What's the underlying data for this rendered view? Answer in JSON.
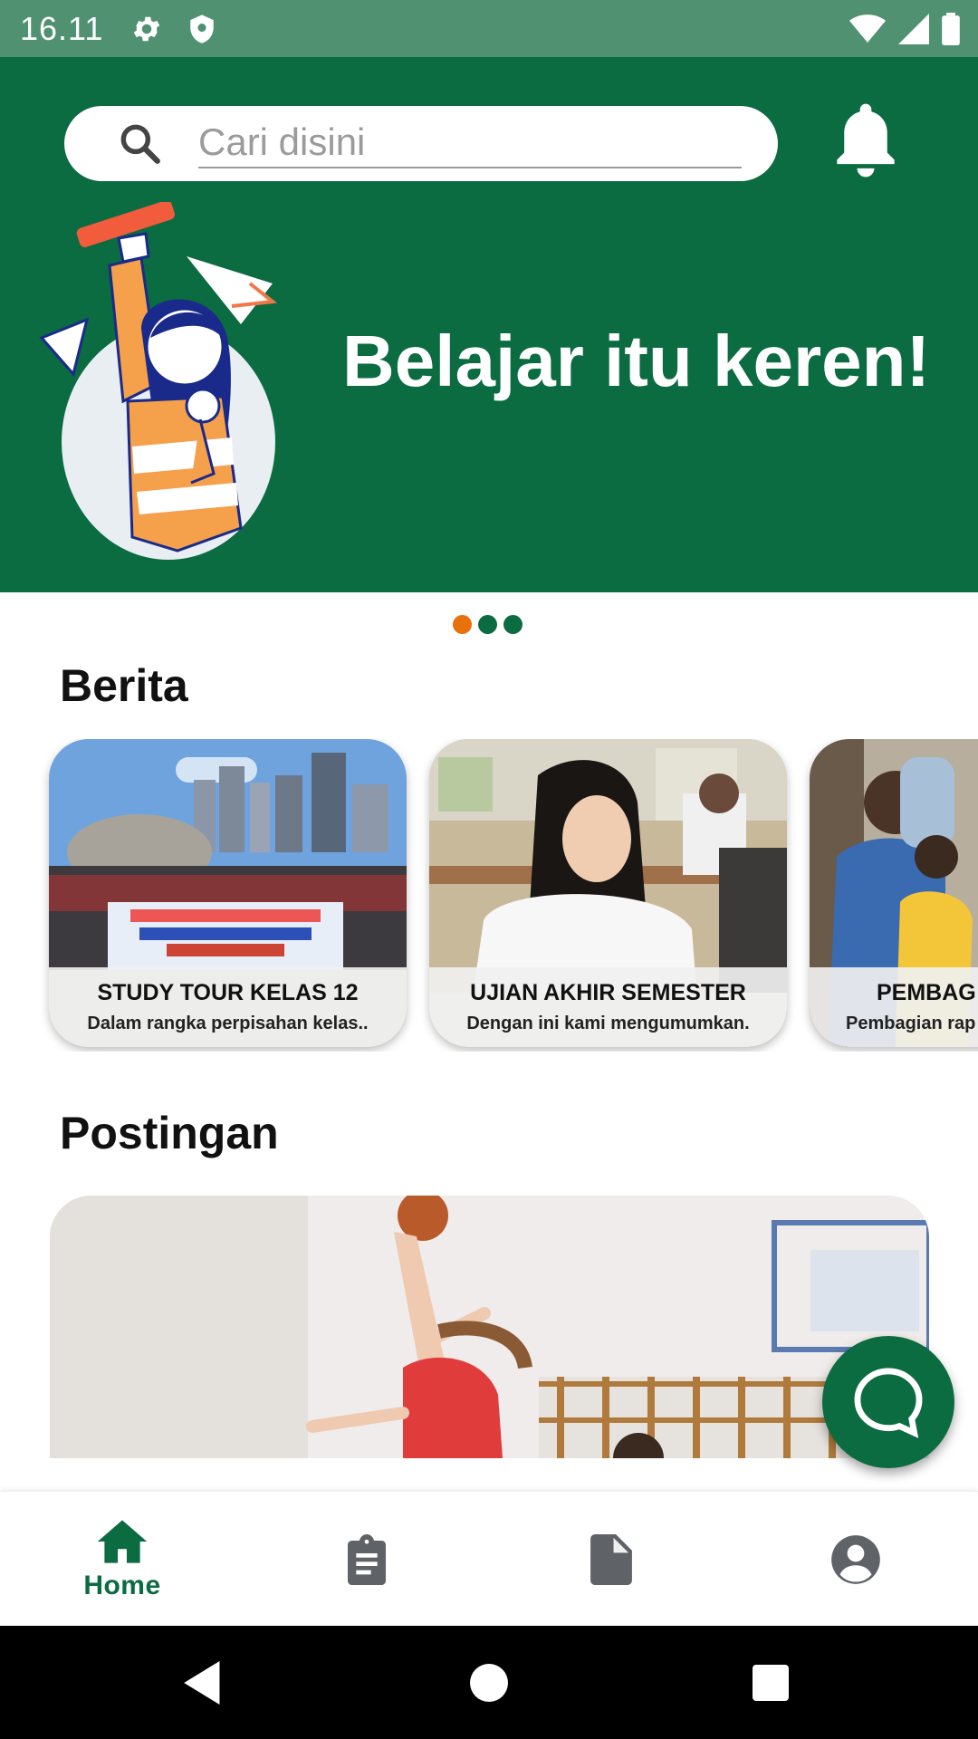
{
  "status_bar": {
    "time": "16.11",
    "icons": [
      "gear-icon",
      "shield-icon",
      "wifi-icon",
      "signal-icon",
      "battery-icon"
    ]
  },
  "header": {
    "search_placeholder": "Cari disini",
    "notification_icon": "bell-icon"
  },
  "hero": {
    "title": "Belajar itu keren!",
    "illustration": "student-illustration",
    "pager": {
      "count": 3,
      "active_index": 0
    }
  },
  "news": {
    "title": "Berita",
    "items": [
      {
        "title": "STUDY TOUR KELAS 12",
        "desc": "Dalam rangka perpisahan kelas.."
      },
      {
        "title": "UJIAN AKHIR SEMESTER",
        "desc": "Dengan ini kami mengumumkan."
      },
      {
        "title": "PEMBAG",
        "desc": "Pembagian rap"
      }
    ]
  },
  "posts": {
    "title": "Postingan"
  },
  "fab": {
    "icon": "chat-icon"
  },
  "bottom_nav": {
    "items": [
      {
        "icon": "home-icon",
        "label": "Home",
        "active": true
      },
      {
        "icon": "clipboard-icon",
        "label": ""
      },
      {
        "icon": "document-icon",
        "label": ""
      },
      {
        "icon": "account-icon",
        "label": ""
      }
    ]
  },
  "colors": {
    "primary": "#0b6b41",
    "status_bar": "#4f9171",
    "accent": "#e8710a",
    "text": "#111111",
    "nav_inactive": "#5f6368"
  }
}
